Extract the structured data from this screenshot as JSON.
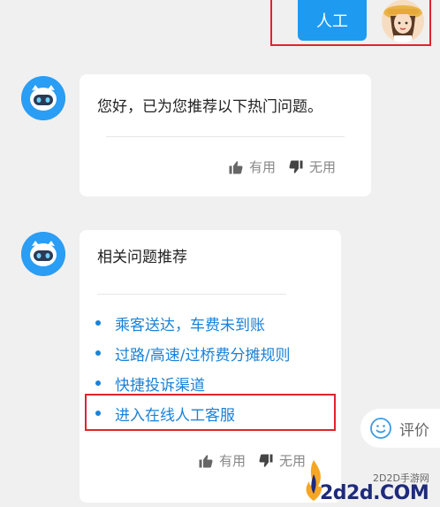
{
  "user_message": {
    "text": "人工"
  },
  "bot_message_1": {
    "text": "您好，已为您推荐以下热门问题。",
    "helpful_label": "有用",
    "not_helpful_label": "无用"
  },
  "bot_message_2": {
    "title": "相关问题推荐",
    "items": [
      "乘客送达，车费未到账",
      "过路/高速/过桥费分摊规则",
      "快捷投诉渠道",
      "进入在线人工客服"
    ],
    "helpful_label": "有用",
    "not_helpful_label": "无用"
  },
  "rate_button": {
    "label": "评价"
  },
  "watermark": {
    "site_cn": "2D2D手游网",
    "domain": "2d2d.COM"
  },
  "colors": {
    "accent": "#1e9bf0",
    "link": "#1a82d8",
    "highlight": "#e0242b",
    "background": "#f0f0f0"
  },
  "icons": [
    "user-avatar-icon",
    "bot-avatar-icon",
    "thumbs-up-icon",
    "thumbs-down-icon",
    "smiley-icon",
    "flame-logo-icon"
  ]
}
